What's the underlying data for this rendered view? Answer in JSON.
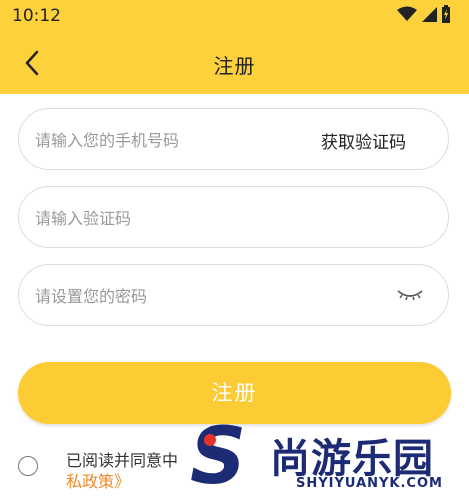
{
  "status_bar": {
    "time": "10:12"
  },
  "header": {
    "title": "注册"
  },
  "form": {
    "phone": {
      "placeholder": "请输入您的手机号码",
      "value": ""
    },
    "get_code_label": "获取验证码",
    "code": {
      "placeholder": "请输入验证码",
      "value": ""
    },
    "password": {
      "placeholder": "请设置您的密码",
      "value": ""
    },
    "register_label": "注册"
  },
  "agreement": {
    "text": "已阅读并同意中",
    "link_label": "私政策》",
    "checked": false
  },
  "watermark": {
    "name_cn": "尚游乐园",
    "name_en": "SHYIYUANYK.COM"
  },
  "colors": {
    "brand_yellow": "#fdd13b",
    "link_orange": "#f08a2e",
    "watermark_blue": "#1d2b74",
    "watermark_red": "#e5332a"
  }
}
